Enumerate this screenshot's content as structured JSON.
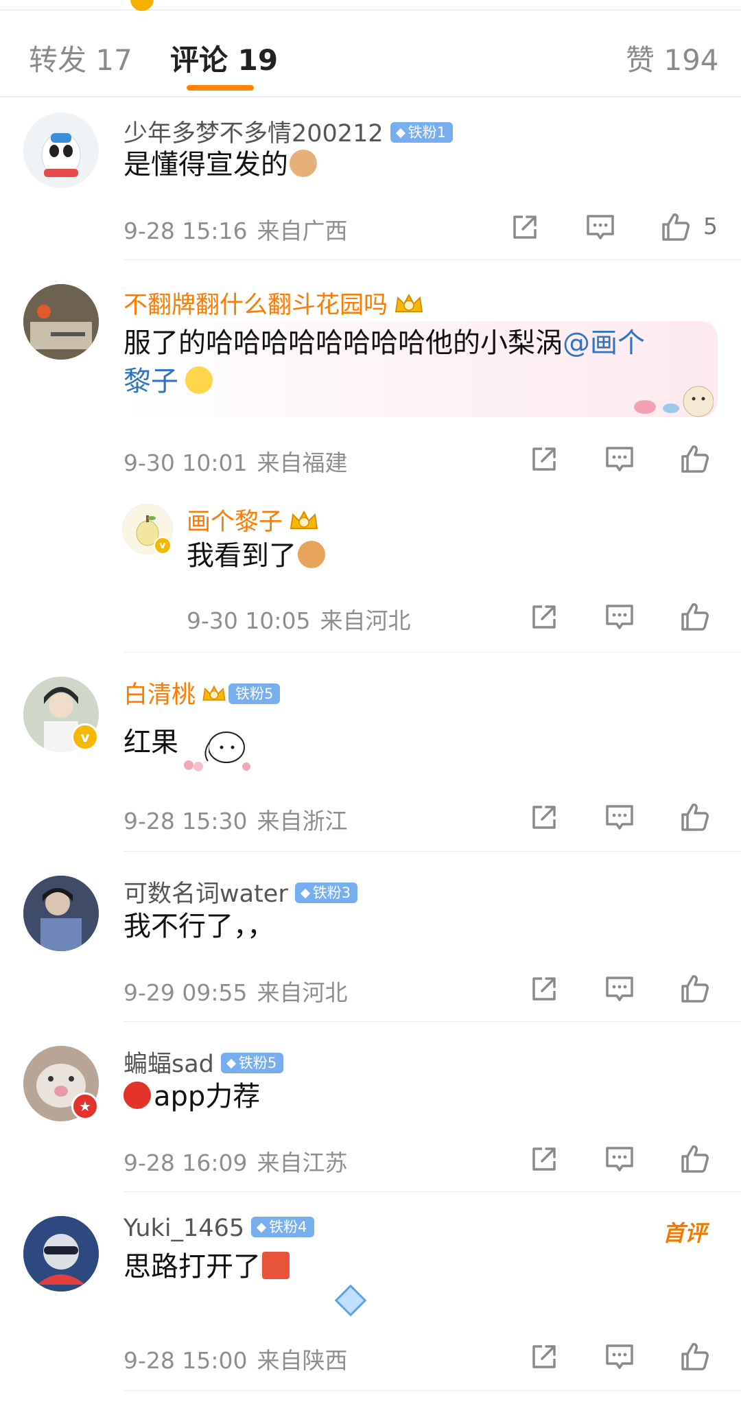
{
  "tabs": {
    "repost": "转发 17",
    "comment": "评论 19",
    "like": "赞 194"
  },
  "comments": [
    {
      "username": "少年多梦不多情200212",
      "fan_badge": "铁粉1",
      "text": "是懂得宣发的",
      "time": "9-28 15:16",
      "location": "来自广西",
      "like_count": "5"
    },
    {
      "username": "不翻牌翻什么翻斗花园吗",
      "text_line1": "服了的哈哈哈哈哈哈哈哈他的小梨涡",
      "mention_line1": "@画个",
      "mention_line2": "黎子",
      "time": "9-30 10:01",
      "location": "来自福建"
    },
    {
      "username": "画个黎子",
      "text": "我看到了",
      "time": "9-30 10:05",
      "location": "来自河北"
    },
    {
      "username": "白清桃",
      "fan_badge": "铁粉5",
      "text": "红果",
      "time": "9-28 15:30",
      "location": "来自浙江"
    },
    {
      "username": "可数名词water",
      "fan_badge": "铁粉3",
      "text": "我不行了，，",
      "time": "9-29 09:55",
      "location": "来自河北"
    },
    {
      "username": "蝙蝠sad",
      "fan_badge": "铁粉5",
      "text": "app力荐",
      "time": "9-28 16:09",
      "location": "来自江苏"
    },
    {
      "username": "Yuki_1465",
      "fan_badge": "铁粉4",
      "first_tag": "首评",
      "text": "思路打开了",
      "time": "9-28 15:00",
      "location": "来自陕西"
    }
  ],
  "colors": {
    "accent": "#ff8200",
    "vip_name": "#ff7a00",
    "mention": "#2f74c0",
    "fan_badge": "#77aef0",
    "meta": "#8e8e8e"
  },
  "icons": [
    "share-icon",
    "comment-icon",
    "like-icon",
    "crown-icon",
    "diamond-icon"
  ]
}
